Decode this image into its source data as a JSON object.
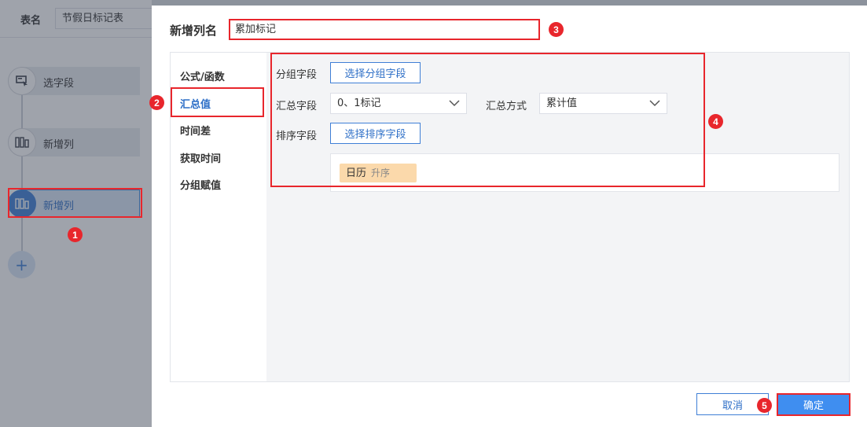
{
  "left": {
    "table_label": "表名",
    "table_name": "节假日标记表",
    "steps": [
      {
        "label": "选字段",
        "icon": "select-field-icon"
      },
      {
        "label": "新增列",
        "icon": "column-icon"
      },
      {
        "label": "新增列",
        "icon": "column-icon",
        "active": true
      }
    ],
    "add_symbol": "+"
  },
  "dialog": {
    "name_label": "新增列名",
    "name_value": "累加标记",
    "menu": [
      "公式/函数",
      "汇总值",
      "时间差",
      "获取时间",
      "分组赋值"
    ],
    "active_menu": "汇总值",
    "group_label": "分组字段",
    "group_button": "选择分组字段",
    "summary_label": "汇总字段",
    "summary_value": "0、1标记",
    "method_label": "汇总方式",
    "method_value": "累计值",
    "sort_label": "排序字段",
    "sort_button": "选择排序字段",
    "sort_tag": {
      "field": "日历",
      "order": "升序"
    },
    "cancel": "取消",
    "confirm": "确定"
  },
  "badges": [
    "1",
    "2",
    "3",
    "4",
    "5"
  ],
  "colors": {
    "accent": "#3f7fd6",
    "annotation_red": "#e8262c",
    "tag_bg": "#fbd9ab",
    "primary_button": "#3f8ef0"
  }
}
